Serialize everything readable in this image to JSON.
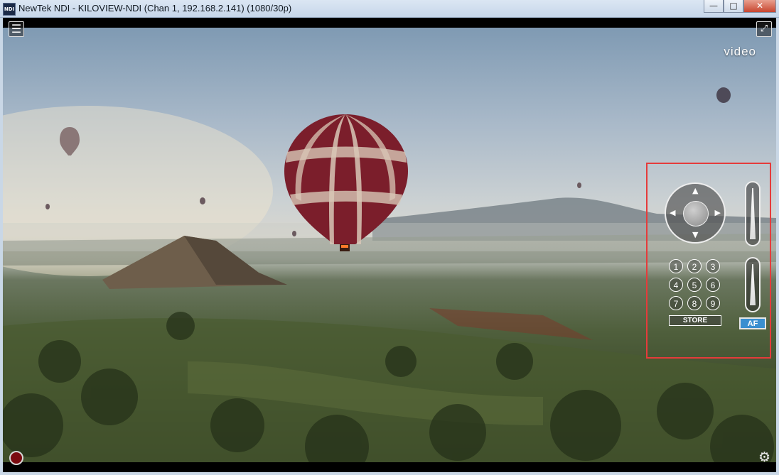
{
  "window": {
    "title": "NewTek NDI - KILOVIEW-NDI (Chan 1, 192.168.2.141) (1080/30p)",
    "app_icon_text": "NDI",
    "minimize": "—",
    "maximize": "□",
    "close": "✕"
  },
  "video": {
    "menu_icon": "☰",
    "fullscreen_icon": "⤢",
    "label": "video",
    "settings_icon": "⚙"
  },
  "ptz": {
    "arrows": {
      "up": "▲",
      "down": "▼",
      "left": "◀",
      "right": "▶"
    },
    "presets": [
      "1",
      "2",
      "3",
      "4",
      "5",
      "6",
      "7",
      "8",
      "9"
    ],
    "store_label": "STORE",
    "af_label": "AF"
  },
  "colors": {
    "highlight_box": "#e53b3b",
    "af_button": "#3a8fd0",
    "record_button": "#7b0a10"
  }
}
